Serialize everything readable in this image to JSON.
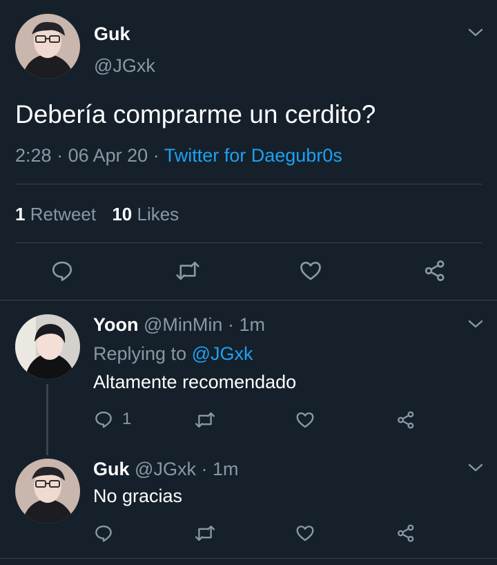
{
  "main_tweet": {
    "name": "Guk",
    "handle": "@JGxk",
    "text": "Debería comprarme un cerdito?",
    "time": "2:28",
    "dot1": "·",
    "date": "06 Apr 20",
    "dot2": "·",
    "source": "Twitter for Daegubr0s",
    "retweet_count": "1",
    "retweet_label": "Retweet",
    "like_count": "10",
    "like_label": "Likes"
  },
  "replies": [
    {
      "name": "Yoon",
      "handle": "@MinMin",
      "dot": "·",
      "time": "1m",
      "replying_prefix": "Replying to",
      "replying_to": "@JGxk",
      "text": "Altamente recomendado",
      "reply_count": "1"
    },
    {
      "name": "Guk",
      "handle": "@JGxk",
      "dot": "·",
      "time": "1m",
      "text": "No gracias"
    }
  ],
  "colors": {
    "background": "#15202b",
    "text": "#ffffff",
    "muted": "#8899a6",
    "accent": "#1da1f2",
    "divider": "#38444d"
  },
  "icons": [
    "chevron-down-icon",
    "reply-icon",
    "retweet-icon",
    "like-icon",
    "share-icon"
  ]
}
